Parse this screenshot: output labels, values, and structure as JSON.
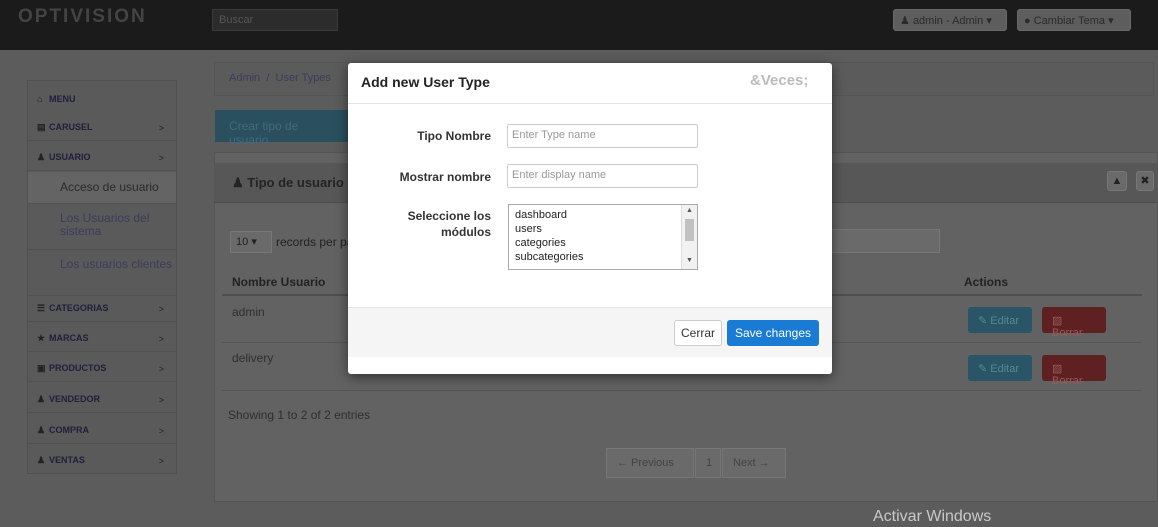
{
  "navbar": {
    "brand": "OPTIVISION",
    "search_placeholder": "Buscar",
    "user_label": "admin - Admin",
    "theme_label": "Cambiar Tema"
  },
  "sidebar": {
    "menu": "MENU",
    "items": [
      {
        "label": "CARUSEL",
        "icon": "image-icon"
      },
      {
        "label": "USUARIO",
        "icon": "user-icon"
      },
      {
        "label": "CATEGORIAS",
        "icon": "list-icon"
      },
      {
        "label": "MARCAS",
        "icon": "star-icon"
      },
      {
        "label": "PRODUCTOS",
        "icon": "briefcase-icon"
      },
      {
        "label": "VENDEDOR",
        "icon": "user-icon"
      },
      {
        "label": "COMPRA",
        "icon": "user-icon"
      },
      {
        "label": "VENTAS",
        "icon": "user-icon"
      }
    ],
    "subitems": [
      "Acceso de usuario",
      "Los Usuarios del sistema",
      "Los usuarios clientes"
    ]
  },
  "main": {
    "breadcrumb_admin": "Admin",
    "breadcrumb_sep": "/",
    "breadcrumb_current": "User Types",
    "create_button": "Crear tipo de usuario",
    "panel_title": "Tipo de usuario",
    "page_length": "10",
    "records_label": "records per pa",
    "col_name": "Nombre Usuario",
    "col_actions": "Actions",
    "rows": [
      {
        "name": "admin",
        "edit": "Editar",
        "delete": "Borrar"
      },
      {
        "name": "delivery",
        "edit": "Editar",
        "delete": "Borrar"
      }
    ],
    "info": "Showing 1 to 2 of 2 entries",
    "pager_prev": "← Previous",
    "pager_page": "1",
    "pager_next": "Next →"
  },
  "modal": {
    "title": "Add new User Type",
    "close_text": "&Veces;",
    "type_name_label": "Tipo Nombre",
    "type_name_placeholder": "Enter Type name",
    "display_name_label": "Mostrar nombre",
    "display_name_placeholder": "Enter display name",
    "modules_label_1": "Seleccione los",
    "modules_label_2": "módulos",
    "modules": [
      "dashboard",
      "users",
      "categories",
      "subcategories"
    ],
    "cancel_button": "Cerrar",
    "save_button": "Save changes"
  },
  "watermark": "Activar Windows"
}
